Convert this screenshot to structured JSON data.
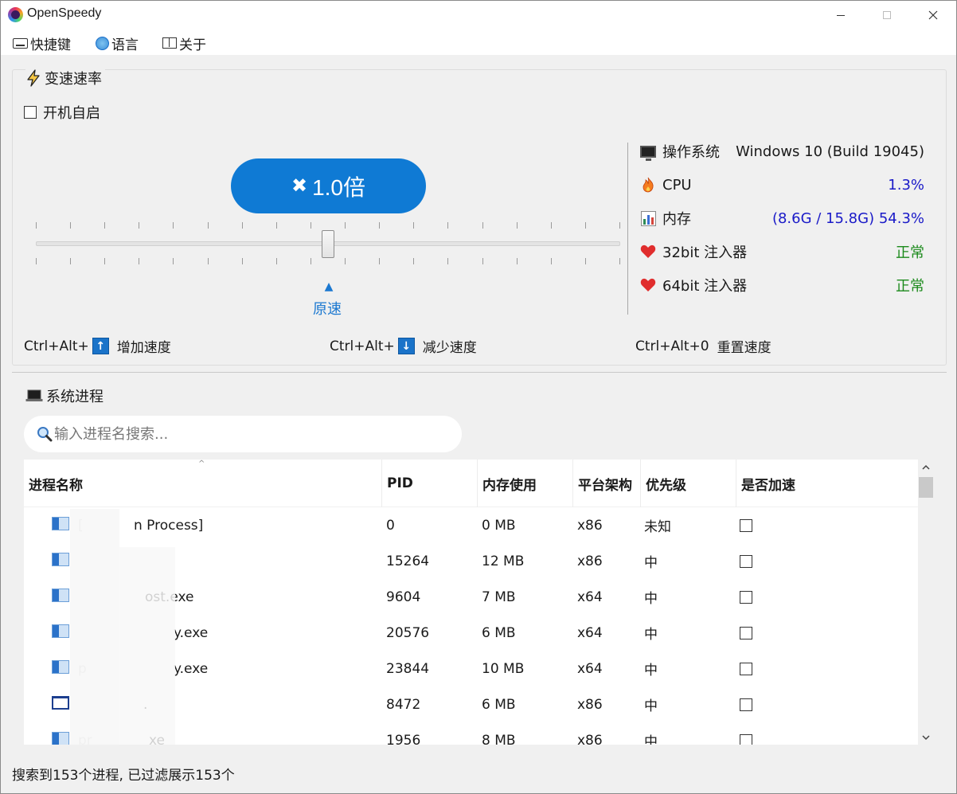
{
  "window": {
    "title": "OpenSpeedy"
  },
  "menu": {
    "items": [
      {
        "label": "快捷键",
        "icon": "keyboard-icon"
      },
      {
        "label": "语言",
        "icon": "globe-icon"
      },
      {
        "label": "关于",
        "icon": "book-icon"
      }
    ]
  },
  "speed": {
    "group_title": "变速速率",
    "autostart_label": "开机自启",
    "autostart_checked": false,
    "multiplier_icon": "✖",
    "multiplier_text": "1.0倍",
    "slider_value": 1.0,
    "original_marker": "▲",
    "original_label": "原速",
    "hotkeys": [
      {
        "prefix": "Ctrl+Alt+",
        "key": "↑",
        "label": "增加速度"
      },
      {
        "prefix": "Ctrl+Alt+",
        "key": "↓",
        "label": "减少速度"
      },
      {
        "prefix": "Ctrl+Alt+0",
        "key": "",
        "label": "重置速度"
      }
    ]
  },
  "system": {
    "os": {
      "label": "操作系统",
      "value": "Windows 10 (Build 19045)"
    },
    "cpu": {
      "label": "CPU",
      "value": "1.3%"
    },
    "memory": {
      "label": "内存",
      "value": "(8.6G / 15.8G) 54.3%"
    },
    "injector32": {
      "label": "32bit 注入器",
      "value": "正常"
    },
    "injector64": {
      "label": "64bit 注入器",
      "value": "正常"
    }
  },
  "process": {
    "group_title": "系统进程",
    "search_placeholder": "输入进程名搜索...",
    "columns": [
      "进程名称",
      "PID",
      "内存使用",
      "平台架构",
      "优先级",
      "是否加速"
    ],
    "rows": [
      {
        "name": "[",
        "name_tail": "n Process]",
        "pid": "0",
        "mem": "0 MB",
        "arch": "x86",
        "priority": "未知",
        "accel": false,
        "icon": "app"
      },
      {
        "name": "",
        "name_tail": "",
        "pid": "15264",
        "mem": "12 MB",
        "arch": "x86",
        "priority": "中",
        "accel": false,
        "icon": "app"
      },
      {
        "name": "",
        "name_tail": "ost.exe",
        "pid": "9604",
        "mem": "7 MB",
        "arch": "x64",
        "priority": "中",
        "accel": false,
        "icon": "app"
      },
      {
        "name": "",
        "name_tail": "y.exe",
        "pid": "20576",
        "mem": "6 MB",
        "arch": "x64",
        "priority": "中",
        "accel": false,
        "icon": "app"
      },
      {
        "name": "p",
        "name_tail": "y.exe",
        "pid": "23844",
        "mem": "10 MB",
        "arch": "x64",
        "priority": "中",
        "accel": false,
        "icon": "app"
      },
      {
        "name": "",
        "name_tail": ".",
        "pid": "8472",
        "mem": "6 MB",
        "arch": "x86",
        "priority": "中",
        "accel": false,
        "icon": "window"
      },
      {
        "name": "pr",
        "name_tail": "xe",
        "pid": "1956",
        "mem": "8 MB",
        "arch": "x86",
        "priority": "中",
        "accel": false,
        "icon": "app"
      }
    ]
  },
  "status": {
    "text": "搜索到153个进程, 已过滤展示153个"
  },
  "colors": {
    "accent": "#0f7ad4",
    "ok": "#1b8a1b",
    "value_blue": "#1a1ac8"
  }
}
